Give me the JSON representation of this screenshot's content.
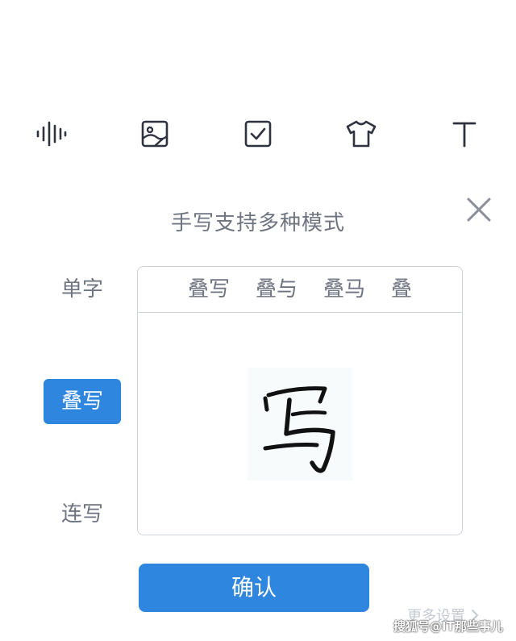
{
  "toolbar": {
    "icons": [
      "voice-wave-icon",
      "image-icon",
      "checkbox-icon",
      "tshirt-icon",
      "text-icon"
    ]
  },
  "panel_title": "手写支持多种模式",
  "modes": [
    {
      "label": "单字",
      "active": false
    },
    {
      "label": "叠写",
      "active": true
    },
    {
      "label": "连写",
      "active": false
    }
  ],
  "preview": {
    "candidates": [
      "叠写",
      "叠与",
      "叠马",
      "叠"
    ],
    "handwritten_char": "写"
  },
  "confirm_label": "确认",
  "more_settings_label": "更多设置",
  "watermark": "搜狐号@IT那些事儿",
  "colors": {
    "accent": "#2e86de",
    "text": "#6f7481",
    "border": "#cfd3da"
  }
}
